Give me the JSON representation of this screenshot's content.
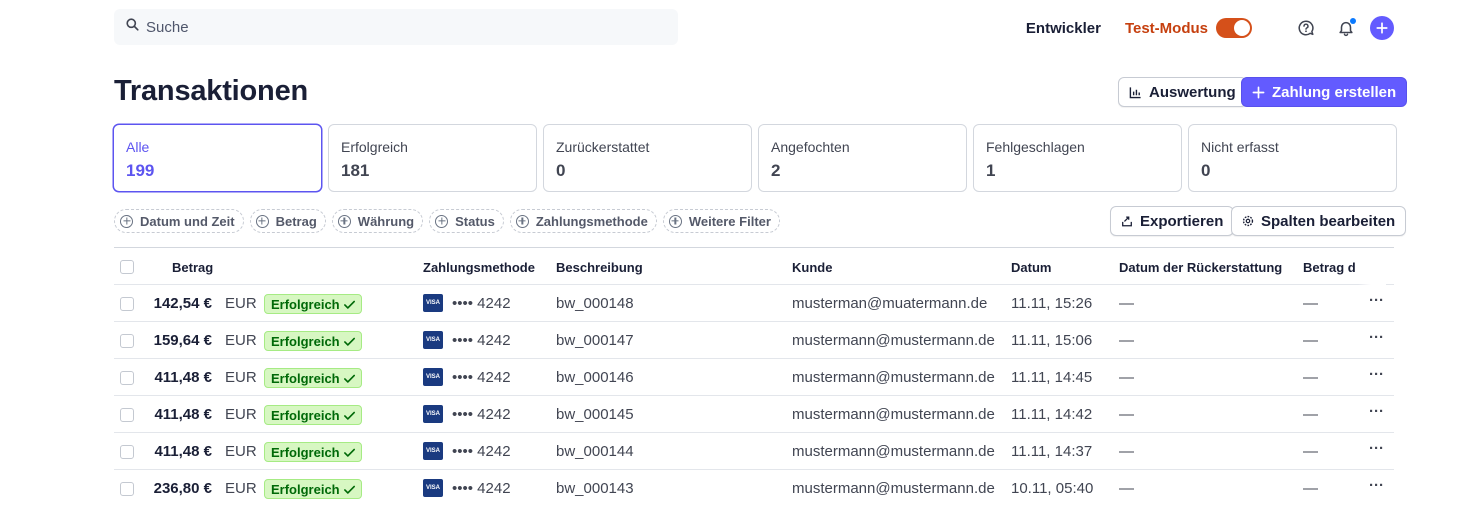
{
  "search": {
    "placeholder": "Suche"
  },
  "topbar": {
    "developer_label": "Entwickler",
    "test_mode_label": "Test-Modus",
    "test_mode_on": true
  },
  "page": {
    "title": "Transaktionen",
    "report_button": "Auswertung",
    "create_button": "Zahlung erstellen"
  },
  "filters": [
    {
      "label": "Alle",
      "count": "199",
      "active": true
    },
    {
      "label": "Erfolgreich",
      "count": "181"
    },
    {
      "label": "Zurückerstattet",
      "count": "0"
    },
    {
      "label": "Angefochten",
      "count": "2"
    },
    {
      "label": "Fehlgeschlagen",
      "count": "1"
    },
    {
      "label": "Nicht erfasst",
      "count": "0"
    }
  ],
  "chips": [
    "Datum und Zeit",
    "Betrag",
    "Währung",
    "Status",
    "Zahlungsmethode",
    "Weitere Filter"
  ],
  "actions": {
    "export": "Exportieren",
    "edit_columns": "Spalten bearbeiten"
  },
  "columns": {
    "amount": "Betrag",
    "payment_method": "Zahlungsmethode",
    "description": "Beschreibung",
    "customer": "Kunde",
    "date": "Datum",
    "refund_date": "Datum der Rückerstattung",
    "refund_amount": "Betrag d"
  },
  "rows": [
    {
      "amount": "142,54 €",
      "currency": "EUR",
      "status": "Erfolgreich",
      "card_brand": "VISA",
      "card": "•••• 4242",
      "description": "bw_000148",
      "customer": "musterman@muatermann.de",
      "date": "11.11, 15:26",
      "refund_date": "—",
      "refund_amount": "—"
    },
    {
      "amount": "159,64 €",
      "currency": "EUR",
      "status": "Erfolgreich",
      "card_brand": "VISA",
      "card": "•••• 4242",
      "description": "bw_000147",
      "customer": "mustermann@mustermann.de",
      "date": "11.11, 15:06",
      "refund_date": "—",
      "refund_amount": "—"
    },
    {
      "amount": "411,48 €",
      "currency": "EUR",
      "status": "Erfolgreich",
      "card_brand": "VISA",
      "card": "•••• 4242",
      "description": "bw_000146",
      "customer": "mustermann@mustermann.de",
      "date": "11.11, 14:45",
      "refund_date": "—",
      "refund_amount": "—"
    },
    {
      "amount": "411,48 €",
      "currency": "EUR",
      "status": "Erfolgreich",
      "card_brand": "VISA",
      "card": "•••• 4242",
      "description": "bw_000145",
      "customer": "mustermann@mustermann.de",
      "date": "11.11, 14:42",
      "refund_date": "—",
      "refund_amount": "—"
    },
    {
      "amount": "411,48 €",
      "currency": "EUR",
      "status": "Erfolgreich",
      "card_brand": "VISA",
      "card": "•••• 4242",
      "description": "bw_000144",
      "customer": "mustermann@mustermann.de",
      "date": "11.11, 14:37",
      "refund_date": "—",
      "refund_amount": "—"
    },
    {
      "amount": "236,80 €",
      "currency": "EUR",
      "status": "Erfolgreich",
      "card_brand": "VISA",
      "card": "•••• 4242",
      "description": "bw_000143",
      "customer": "mustermann@mustermann.de",
      "date": "10.11, 05:40",
      "refund_date": "—",
      "refund_amount": "—"
    }
  ],
  "colors": {
    "accent": "#635bff",
    "test_mode": "#c6400f",
    "success_bg": "#d7f7c2",
    "success_text": "#006908"
  }
}
